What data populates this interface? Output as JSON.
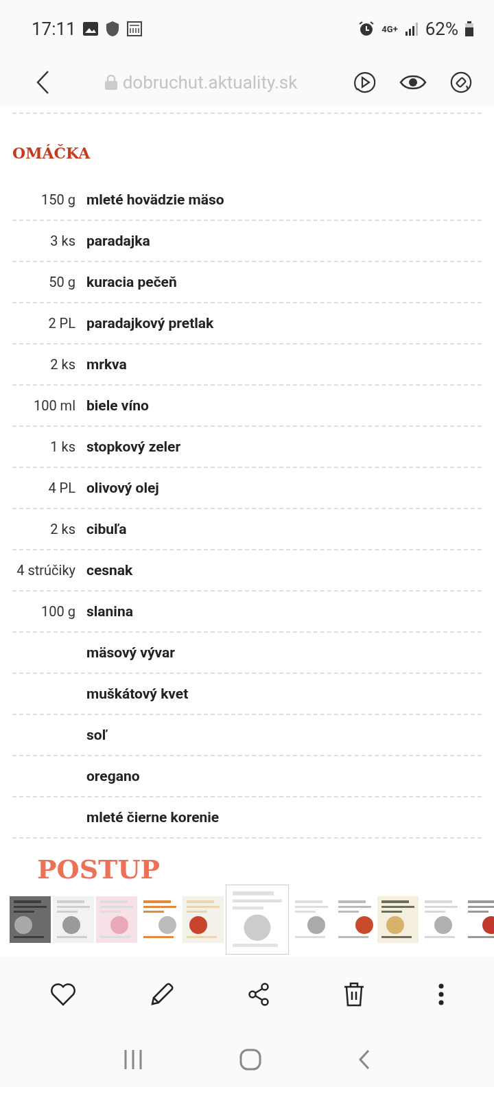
{
  "status_bar": {
    "time": "17:11",
    "network": "4G+",
    "battery": "62%"
  },
  "address_bar": {
    "url": "dobruchut.aktuality.sk"
  },
  "section": {
    "title": "OMÁČKA"
  },
  "ingredients": [
    {
      "amount": "150 g",
      "name": "mleté hovädzie mäso"
    },
    {
      "amount": "3 ks",
      "name": "paradajka"
    },
    {
      "amount": "50 g",
      "name": "kuracia pečeň"
    },
    {
      "amount": "2 PL",
      "name": "paradajkový pretlak"
    },
    {
      "amount": "2 ks",
      "name": "mrkva"
    },
    {
      "amount": "100 ml",
      "name": "biele víno"
    },
    {
      "amount": "1 ks",
      "name": "stopkový zeler"
    },
    {
      "amount": "4 PL",
      "name": "olivový olej"
    },
    {
      "amount": "2 ks",
      "name": "cibuľa"
    },
    {
      "amount": "4 strúčiky",
      "name": "cesnak"
    },
    {
      "amount": "100 g",
      "name": "slanina"
    },
    {
      "name": "mäsový vývar"
    },
    {
      "name": "muškátový kvet"
    },
    {
      "name": "soľ"
    },
    {
      "name": "oregano"
    },
    {
      "name": "mleté čierne korenie"
    }
  ],
  "next_section": {
    "title": "POSTUP"
  },
  "thumbnails": [
    {
      "kind": "picture",
      "selected": false
    },
    {
      "kind": "picture",
      "selected": false
    },
    {
      "kind": "picture",
      "selected": false
    },
    {
      "kind": "picture",
      "selected": false
    },
    {
      "kind": "picture",
      "selected": false
    },
    {
      "kind": "picture",
      "selected": true
    },
    {
      "kind": "picture",
      "selected": false
    },
    {
      "kind": "picture",
      "selected": false
    },
    {
      "kind": "picture",
      "selected": false
    },
    {
      "kind": "picture",
      "selected": false
    },
    {
      "kind": "picture",
      "selected": false
    }
  ]
}
